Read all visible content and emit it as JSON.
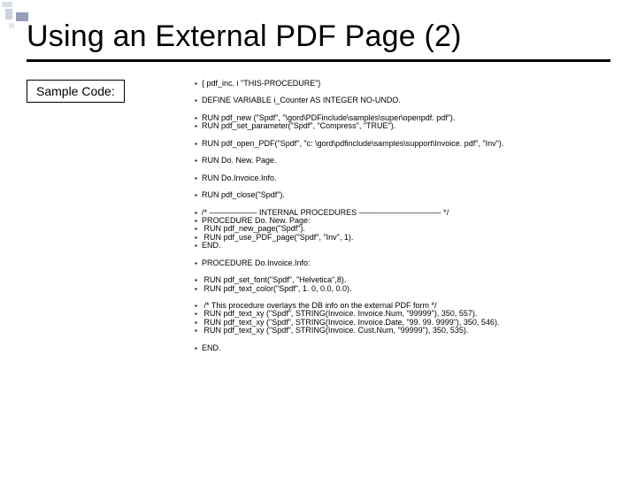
{
  "title": "Using an External PDF Page (2)",
  "label": "Sample Code:",
  "blocks": {
    "b1": [
      "{ pdf_inc. i \"THIS-PROCEDURE\"}"
    ],
    "b2": [
      "DEFINE VARIABLE i_Counter AS INTEGER NO-UNDO."
    ],
    "b3": [
      "RUN pdf_new (\"Spdf\", \"\\gord\\PDFinclude\\samples\\super\\openpdf. pdf\").",
      "RUN pdf_set_parameter(\"Spdf\", \"Compress\", \"TRUE\")."
    ],
    "b4": [
      "RUN pdf_open_PDF(\"Spdf\", \"c: \\gord\\pdfinclude\\samples\\support\\Invoice. pdf\", \"Inv\")."
    ],
    "b5": [
      "RUN Do. New. Page."
    ],
    "b6": [
      "RUN Do.Invoice.Info."
    ],
    "b7": [
      "RUN pdf_close(\"Spdf\")."
    ],
    "b8": [
      "/* —————— INTERNAL PROCEDURES ——————————- */",
      "PROCEDURE Do. New. Page:",
      " RUN pdf_new_page(\"Spdf\").",
      " RUN pdf_use_PDF_page(\"Spdf\", \"Inv\", 1).",
      "END."
    ],
    "b9": [
      "PROCEDURE Do.Invoice.Info:"
    ],
    "b10": [
      " RUN pdf_set_font(\"Spdf\", \"Helvetica\",8).",
      " RUN pdf_text_color(\"Spdf\", 1. 0, 0.0, 0.0)."
    ],
    "b11": [
      " /* This procedure overlays the DB info on the external PDF form */",
      " RUN pdf_text_xy (\"Spdf\", STRING(Invoice. Invoice.Num, \"99999\"), 350, 557).",
      " RUN pdf_text_xy (\"Spdf\", STRING(Invoice. Invoice.Date, \"99. 99. 9999\"), 350, 546).",
      " RUN pdf_text_xy (\"Spdf\", STRING(Invoice. Cust.Num, \"99999\"), 350, 535)."
    ],
    "b12": [
      "END."
    ]
  }
}
